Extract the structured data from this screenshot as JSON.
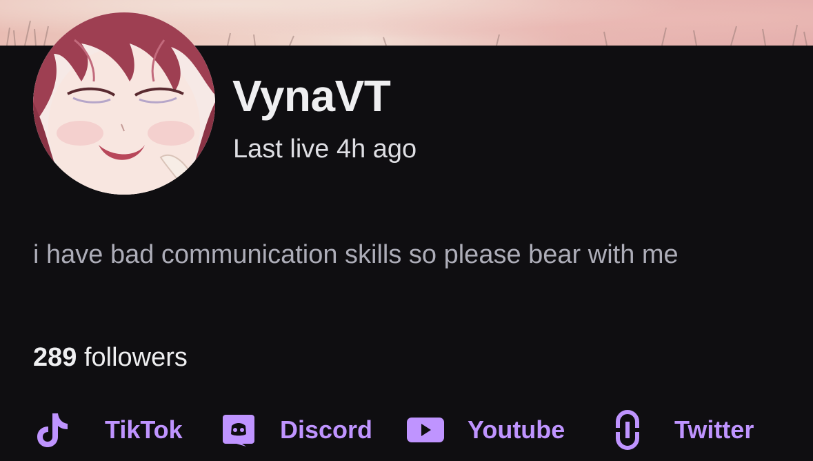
{
  "profile": {
    "name": "VynaVT",
    "last_live": "Last live 4h ago",
    "bio": "i have bad communication skills so please bear with me",
    "followers": {
      "count": "289",
      "label": "followers"
    }
  },
  "socials": [
    {
      "label": "TikTok",
      "icon": "tiktok-icon"
    },
    {
      "label": "Discord",
      "icon": "discord-icon"
    },
    {
      "label": "Youtube",
      "icon": "youtube-icon"
    },
    {
      "label": "Twitter",
      "icon": "link-icon"
    }
  ],
  "colors": {
    "background": "#0f0e11",
    "accent": "#bf94ff",
    "text_primary": "#efeff1",
    "text_muted": "#adadb8"
  }
}
